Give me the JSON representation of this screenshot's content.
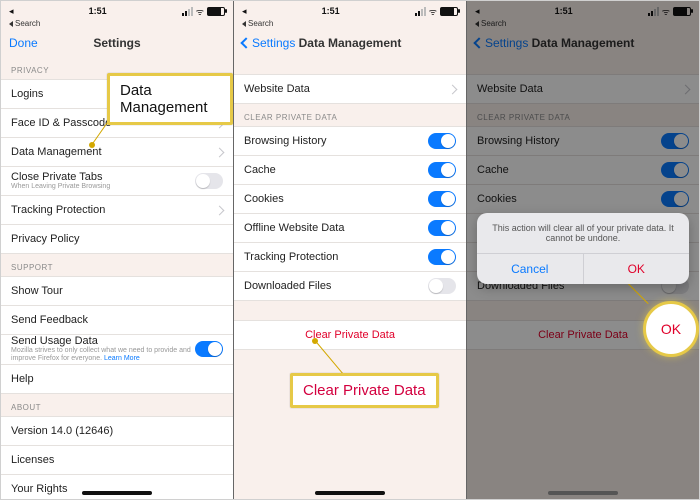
{
  "status": {
    "time": "1:51",
    "search_back": "Search"
  },
  "panel1": {
    "nav": {
      "left": "Done",
      "title": "Settings"
    },
    "sec_privacy": "Privacy",
    "rows": {
      "logins": "Logins",
      "faceid": "Face ID & Passcode",
      "datamgmt": "Data Management",
      "closetabs": "Close Private Tabs",
      "closetabs_sub": "When Leaving Private Browsing",
      "tracking": "Tracking Protection",
      "privacypolicy": "Privacy Policy"
    },
    "sec_support": "Support",
    "support": {
      "showtour": "Show Tour",
      "sendfb": "Send Feedback",
      "sendusage": "Send Usage Data",
      "sendusage_sub": "Mozilla strives to only collect what we need to provide and improve Firefox for everyone.",
      "sendusage_link": "Learn More",
      "help": "Help"
    },
    "sec_about": "About",
    "about": {
      "version": "Version 14.0 (12646)",
      "licenses": "Licenses",
      "rights": "Your Rights"
    },
    "callout": "Data Management"
  },
  "panel2": {
    "nav": {
      "back": "Settings",
      "title": "Data Management"
    },
    "row_website": "Website Data",
    "sec_clear": "Clear Private Data",
    "rows": {
      "history": "Browsing History",
      "cache": "Cache",
      "cookies": "Cookies",
      "offline": "Offline Website Data",
      "tracking": "Tracking Protection",
      "downloads": "Downloaded Files"
    },
    "clear_btn": "Clear Private Data",
    "callout": "Clear Private Data"
  },
  "panel3": {
    "nav": {
      "back": "Settings",
      "title": "Data Management"
    },
    "modal": {
      "msg": "This action will clear all of your private data. It cannot be undone.",
      "cancel": "Cancel",
      "ok": "OK"
    },
    "spot": "OK"
  }
}
